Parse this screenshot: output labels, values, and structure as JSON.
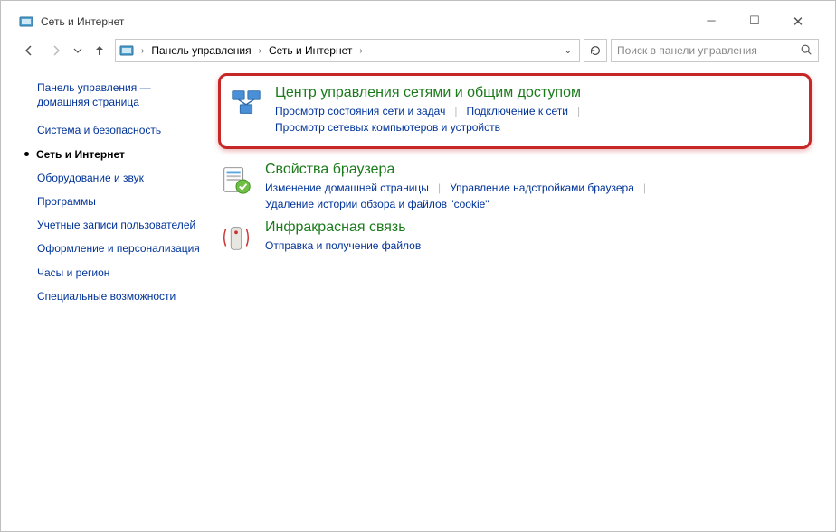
{
  "window": {
    "title": "Сеть и Интернет"
  },
  "breadcrumb": {
    "root": "Панель управления",
    "current": "Сеть и Интернет"
  },
  "search": {
    "placeholder": "Поиск в панели управления"
  },
  "sidebar": {
    "home": "Панель управления — домашняя страница",
    "items": [
      {
        "label": "Система и безопасность",
        "current": false
      },
      {
        "label": "Сеть и Интернет",
        "current": true
      },
      {
        "label": "Оборудование и звук",
        "current": false
      },
      {
        "label": "Программы",
        "current": false
      },
      {
        "label": "Учетные записи пользователей",
        "current": false
      },
      {
        "label": "Оформление и персонализация",
        "current": false
      },
      {
        "label": "Часы и регион",
        "current": false
      },
      {
        "label": "Специальные возможности",
        "current": false
      }
    ]
  },
  "categories": [
    {
      "title": "Центр управления сетями и общим доступом",
      "highlighted": true,
      "links": [
        "Просмотр состояния сети и задач",
        "Подключение к сети",
        "Просмотр сетевых компьютеров и устройств"
      ]
    },
    {
      "title": "Свойства браузера",
      "highlighted": false,
      "links": [
        "Изменение домашней страницы",
        "Управление надстройками браузера",
        "Удаление истории обзора и файлов \"cookie\""
      ]
    },
    {
      "title": "Инфракрасная связь",
      "highlighted": false,
      "links": [
        "Отправка и получение файлов"
      ]
    }
  ]
}
